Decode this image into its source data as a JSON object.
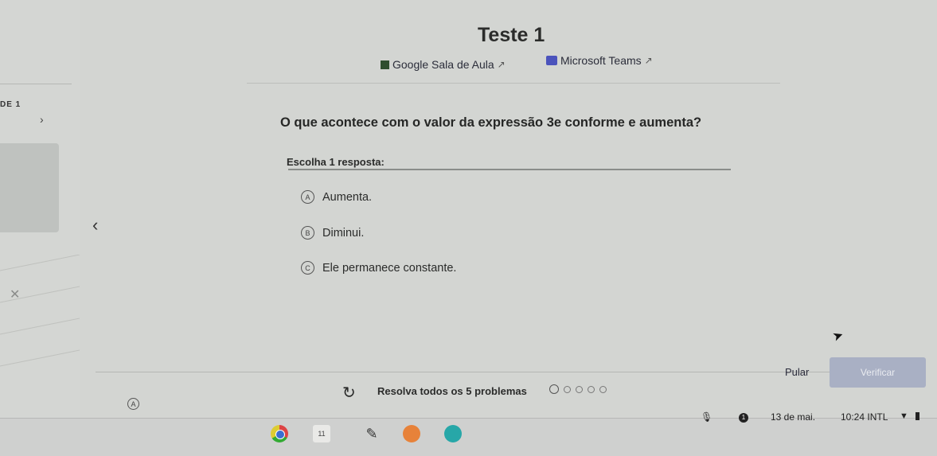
{
  "sidebar": {
    "section_label": "DE 1"
  },
  "header": {
    "title": "Teste 1",
    "links": [
      {
        "label": "Google Sala de Aula"
      },
      {
        "label": "Microsoft Teams"
      }
    ]
  },
  "question": {
    "text": "O que acontece com o valor da expressão 3e conforme e aumenta?",
    "prompt": "Escolha 1 resposta:",
    "options": [
      {
        "letter": "A",
        "label": "Aumenta."
      },
      {
        "letter": "B",
        "label": "Diminui."
      },
      {
        "letter": "C",
        "label": "Ele permanece constante."
      }
    ]
  },
  "footer": {
    "progress_text": "Resolva todos os 5 problemas",
    "progress_total": 5,
    "skip_label": "Pular",
    "check_label": "Verificar"
  },
  "shelf": {
    "calendar_icon_text": "11",
    "notification_badge": "1",
    "date": "13 de mai.",
    "time": "10:24",
    "input_method": "INTL"
  },
  "icons": {
    "chevron_right": "chevron-right-icon",
    "chevron_left": "chevron-left-icon",
    "external_link": "external-link-icon",
    "refresh": "refresh-icon",
    "accessibility": "accessibility-icon"
  },
  "colors": {
    "check_button_bg": "#a9b0c4",
    "teams_brand": "#4b53bc",
    "classroom_brand": "#2f4f2f"
  }
}
